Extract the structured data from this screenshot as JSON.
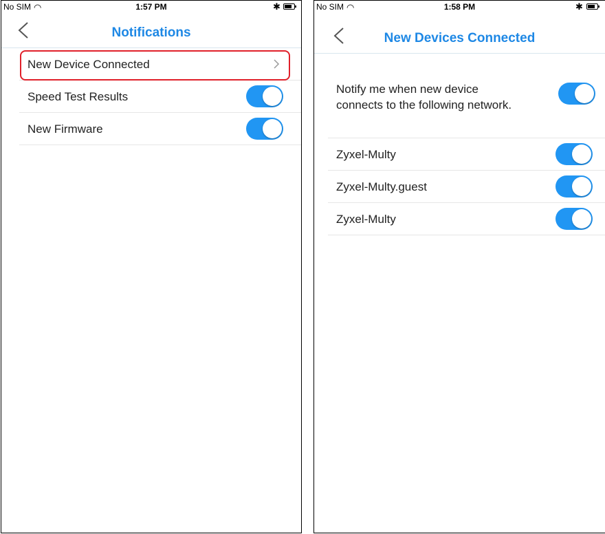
{
  "left": {
    "status": {
      "carrier": "No SIM",
      "time": "1:57 PM"
    },
    "title": "Notifications",
    "rows": [
      {
        "label": "New Device Connected"
      },
      {
        "label": "Speed Test Results",
        "on": true
      },
      {
        "label": "New Firmware",
        "on": true
      }
    ]
  },
  "right": {
    "status": {
      "carrier": "No SIM",
      "time": "1:58 PM"
    },
    "title": "New Devices Connected",
    "notify_line1": "Notify me when new device",
    "notify_line2": "connects to the following network.",
    "notify_on": true,
    "networks": [
      {
        "label": "Zyxel-Multy",
        "on": true
      },
      {
        "label": "Zyxel-Multy.guest",
        "on": true
      },
      {
        "label": "Zyxel-Multy",
        "on": true
      }
    ]
  },
  "colors": {
    "accent": "#1e88e5",
    "toggle_on": "#2196f3",
    "highlight": "#e0202a"
  },
  "icons": [
    "wifi-icon",
    "bluetooth-icon",
    "battery-icon",
    "back-chevron-icon",
    "chevron-right-icon"
  ]
}
